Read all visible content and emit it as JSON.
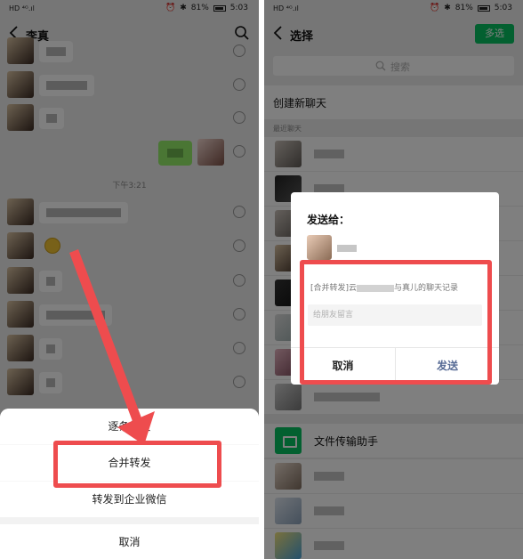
{
  "status_bar": {
    "left": "HD ⁴ᴳ.ıl",
    "battery_percent": "81%",
    "time": "5:03"
  },
  "left_screen": {
    "chat_title": "李真",
    "time_divider": "下午3:21",
    "action_sheet": {
      "item_1": "逐条转发",
      "item_2": "合并转发",
      "item_3": "转发到企业微信",
      "cancel": "取消"
    }
  },
  "right_screen": {
    "title": "选择",
    "multi_select": "多选",
    "search_placeholder": "搜索",
    "create_new_chat": "创建新聊天",
    "recent_label": "最近聊天",
    "file_transfer": "文件传输助手",
    "dialog": {
      "title": "发送给：",
      "content_prefix": "[合并转发]云",
      "content_suffix": "与真儿的聊天记录",
      "message_placeholder": "给朋友留言",
      "cancel": "取消",
      "send": "发送"
    }
  },
  "colors": {
    "highlight": "#ee4c4e",
    "wechat_green": "#07c160",
    "send_blue": "#576b95"
  }
}
